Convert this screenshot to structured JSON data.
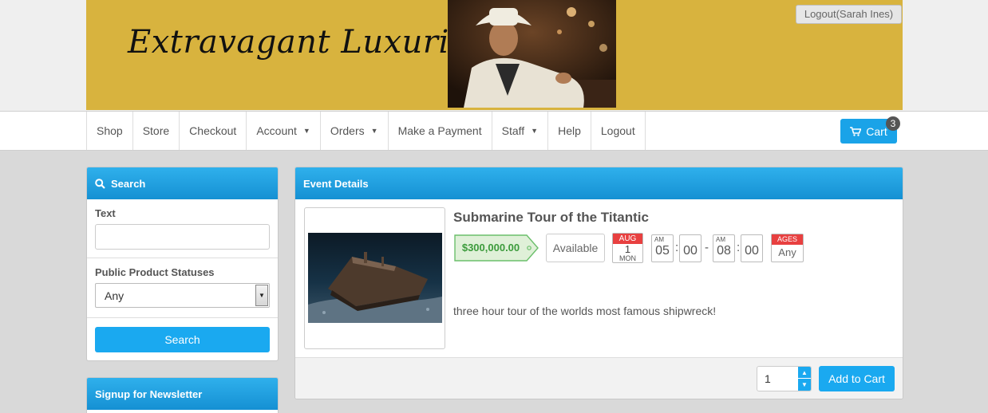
{
  "header": {
    "logo_text": "Extravagant Luxuries",
    "logout_label": "Logout(Sarah Ines)"
  },
  "nav": {
    "items": [
      {
        "label": "Shop",
        "dropdown": false
      },
      {
        "label": "Store",
        "dropdown": false
      },
      {
        "label": "Checkout",
        "dropdown": false
      },
      {
        "label": "Account",
        "dropdown": true
      },
      {
        "label": "Orders",
        "dropdown": true
      },
      {
        "label": "Make a Payment",
        "dropdown": false
      },
      {
        "label": "Staff",
        "dropdown": true
      },
      {
        "label": "Help",
        "dropdown": false
      },
      {
        "label": "Logout",
        "dropdown": false
      }
    ],
    "cart_label": "Cart",
    "cart_count": "3"
  },
  "search_panel": {
    "title": "Search",
    "text_label": "Text",
    "text_value": "",
    "status_label": "Public Product Statuses",
    "status_value": "Any",
    "search_button": "Search"
  },
  "newsletter_panel": {
    "title": "Signup for Newsletter"
  },
  "event": {
    "panel_title": "Event Details",
    "title": "Submarine Tour of the Titantic",
    "price": "$300,000.00",
    "availability": "Available",
    "date": {
      "month": "AUG",
      "day": "1",
      "weekday": "MON"
    },
    "start": {
      "ampm": "AM",
      "hour": "05",
      "minute": "00"
    },
    "end": {
      "ampm": "AM",
      "hour": "08",
      "minute": "00"
    },
    "ages_label": "AGES",
    "ages_value": "Any",
    "description": "three hour tour of the worlds most famous shipwreck!",
    "quantity": "1",
    "add_to_cart": "Add to Cart"
  },
  "colors": {
    "banner": "#d8b33e",
    "accent": "#1aa9f0",
    "price_green": "#3c9b3c",
    "calendar_red": "#e84040"
  }
}
